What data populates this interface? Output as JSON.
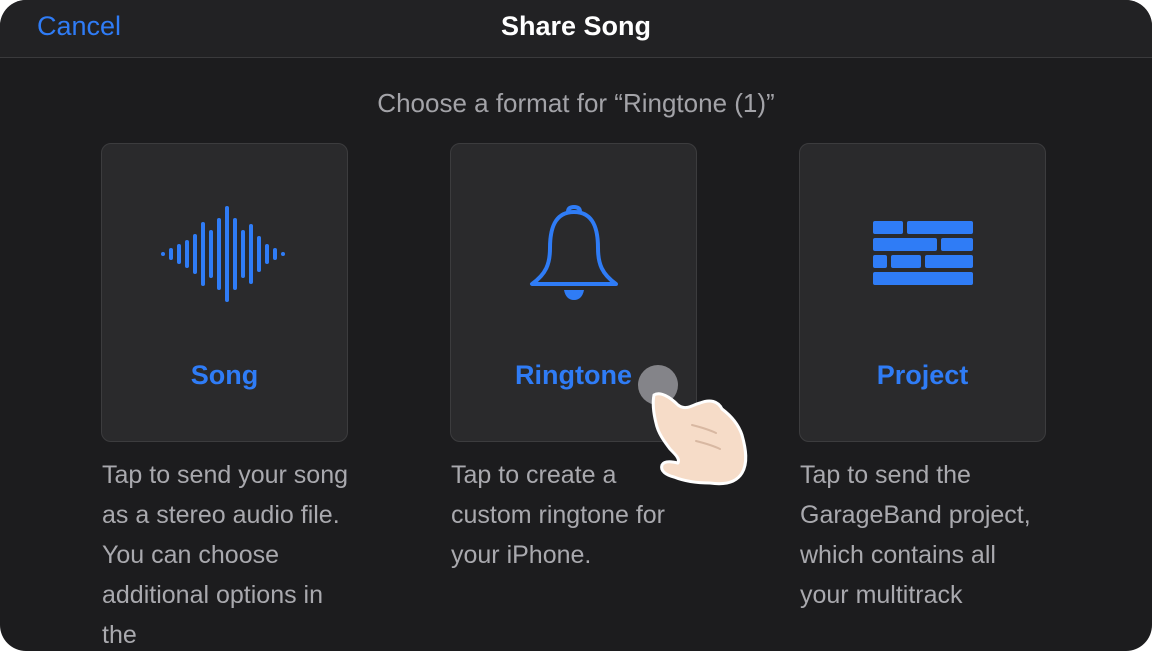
{
  "nav": {
    "cancel_label": "Cancel",
    "title": "Share Song"
  },
  "subtitle": "Choose a format for “Ringtone (1)”",
  "options": [
    {
      "label": "Song",
      "icon": "waveform-icon",
      "description": "Tap to send your song as a stereo audio file. You can choose additional options in the"
    },
    {
      "label": "Ringtone",
      "icon": "bell-icon",
      "description": "Tap to create a custom ringtone for your iPhone."
    },
    {
      "label": "Project",
      "icon": "project-tracks-icon",
      "description": "Tap to send the GarageBand project, which contains all your multitrack"
    }
  ],
  "colors": {
    "accent": "#2f7cf6",
    "background": "#1c1c1e",
    "card": "#2a2a2c",
    "secondary_text": "#a9a9ae"
  }
}
